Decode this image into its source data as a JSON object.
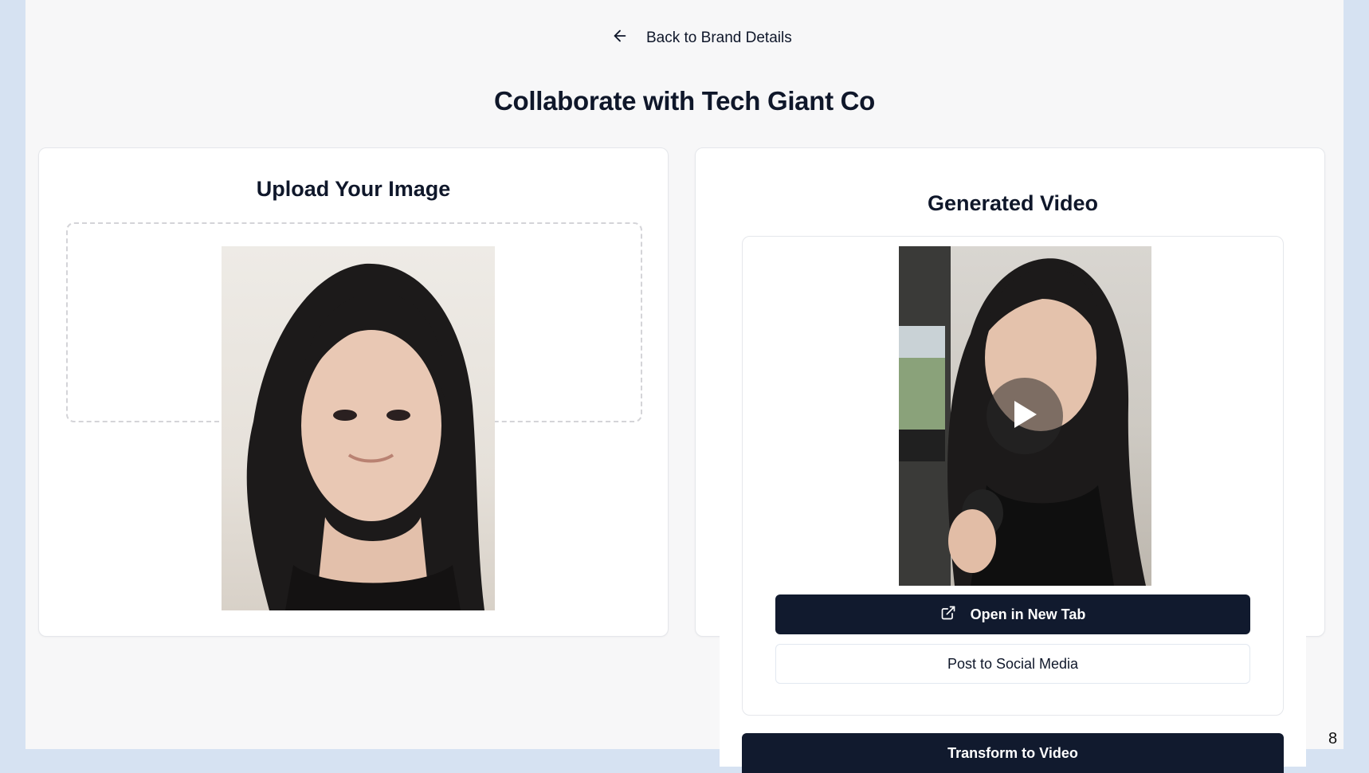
{
  "nav": {
    "back_label": "Back to Brand Details",
    "back_icon": "arrow-left-icon"
  },
  "page": {
    "title": "Collaborate with Tech Giant Co"
  },
  "upload": {
    "title": "Upload Your Image"
  },
  "generated": {
    "title": "Generated Video",
    "play_icon": "play-icon",
    "open_tab_label": "Open in New Tab",
    "open_tab_icon": "external-link-icon",
    "post_label": "Post to Social Media"
  },
  "actions": {
    "transform_label": "Transform to Video"
  },
  "corner_number": "8",
  "colors": {
    "primary": "#111a2e",
    "page_bg": "#f7f7f8",
    "outer_bg": "#d6e2f2"
  }
}
